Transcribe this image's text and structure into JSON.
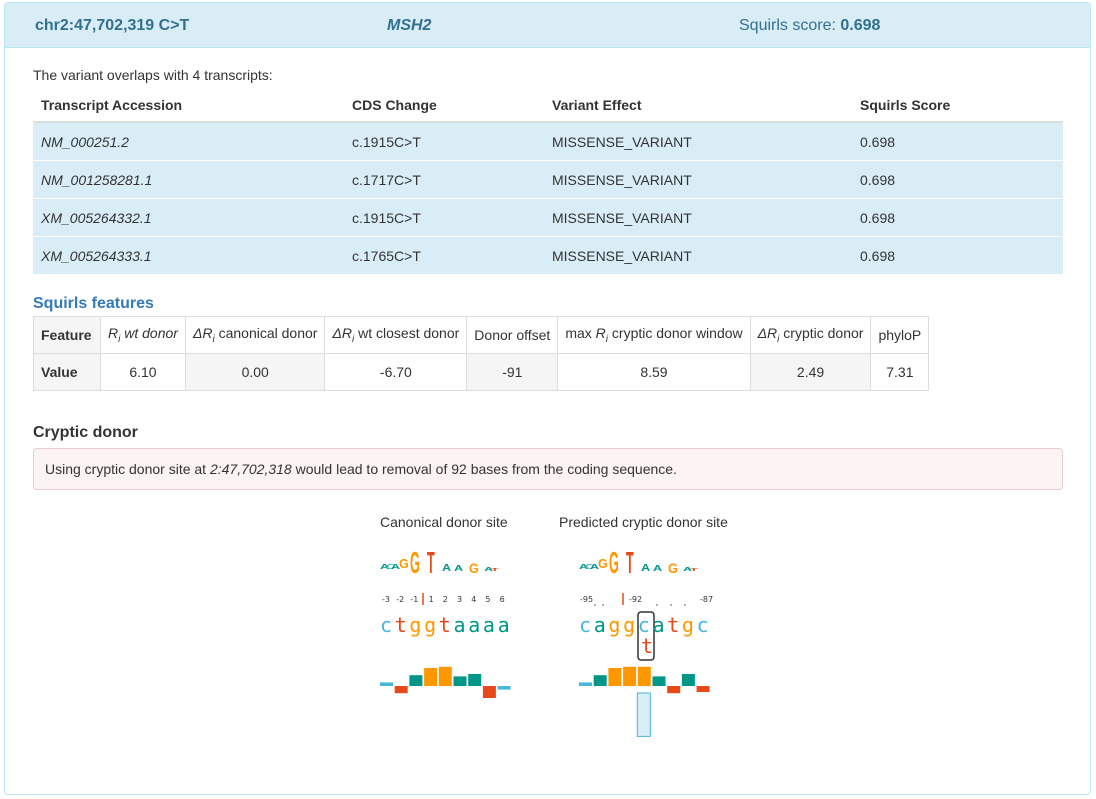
{
  "header": {
    "variant": "chr2:47,702,319 C>T",
    "gene": "MSH2",
    "score_label": "Squirls score:",
    "score_value": "0.698"
  },
  "overlap_text": "The variant overlaps with 4 transcripts:",
  "transcripts": {
    "headers": [
      "Transcript Accession",
      "CDS Change",
      "Variant Effect",
      "Squirls Score"
    ],
    "rows": [
      {
        "accession": "NM_000251.2",
        "cds": "c.1915C>T",
        "effect": "MISSENSE_VARIANT",
        "score": "0.698"
      },
      {
        "accession": "NM_001258281.1",
        "cds": "c.1717C>T",
        "effect": "MISSENSE_VARIANT",
        "score": "0.698"
      },
      {
        "accession": "XM_005264332.1",
        "cds": "c.1915C>T",
        "effect": "MISSENSE_VARIANT",
        "score": "0.698"
      },
      {
        "accession": "XM_005264333.1",
        "cds": "c.1765C>T",
        "effect": "MISSENSE_VARIANT",
        "score": "0.698"
      }
    ]
  },
  "features": {
    "title": "Squirls features",
    "row_feature_label": "Feature",
    "row_value_label": "Value",
    "columns": [
      {
        "prefix": "",
        "ri": "R",
        "sub": "i",
        "suffix": " wt donor",
        "value": "6.10"
      },
      {
        "prefix": "Δ",
        "ri": "R",
        "sub": "i",
        "suffix": " canonical donor",
        "value": "0.00"
      },
      {
        "prefix": "Δ",
        "ri": "R",
        "sub": "i",
        "suffix": " wt closest donor",
        "value": "-6.70"
      },
      {
        "prefix": "",
        "ri": "",
        "sub": "",
        "suffix": "Donor offset",
        "value": "-91"
      },
      {
        "prefix": "max ",
        "ri": "R",
        "sub": "i",
        "suffix": " cryptic donor window",
        "value": "8.59"
      },
      {
        "prefix": "Δ",
        "ri": "R",
        "sub": "i",
        "suffix": " cryptic donor",
        "value": "2.49"
      },
      {
        "prefix": "",
        "ri": "",
        "sub": "",
        "suffix": "phyloP",
        "value": "7.31"
      }
    ]
  },
  "cryptic": {
    "title": "Cryptic donor",
    "alert_prefix": "Using cryptic donor site at ",
    "alert_position": "2:47,702,318",
    "alert_suffix": " would lead to removal of 92 bases from the coding sequence.",
    "canonical": {
      "label": "Canonical donor site",
      "ticks": [
        "-3",
        "-2",
        "-1",
        "1",
        "2",
        "3",
        "4",
        "5",
        "6"
      ],
      "sequence": [
        "c",
        "t",
        "g",
        "g",
        "t",
        "a",
        "a",
        "a",
        "a"
      ],
      "bar_values": [
        0.3,
        -0.6,
        0.9,
        1.5,
        1.6,
        0.8,
        1.0,
        -1.0,
        -0.3
      ]
    },
    "cryptic_site": {
      "label": "Predicted cryptic donor site",
      "ticks": [
        "-95",
        "-92",
        "-87"
      ],
      "sequence": [
        "c",
        "a",
        "g",
        "g",
        "c",
        "a",
        "t",
        "g",
        "c"
      ],
      "alt_base": "t",
      "alt_index": 4,
      "bar_values": [
        0.3,
        0.9,
        1.5,
        1.6,
        1.6,
        0.8,
        -0.6,
        1.0,
        -0.5
      ],
      "alt_bar_value": -3.1
    },
    "colors": {
      "a": "#009688",
      "c": "#46b8da",
      "g": "#ff9800",
      "t": "#e64a19"
    }
  }
}
